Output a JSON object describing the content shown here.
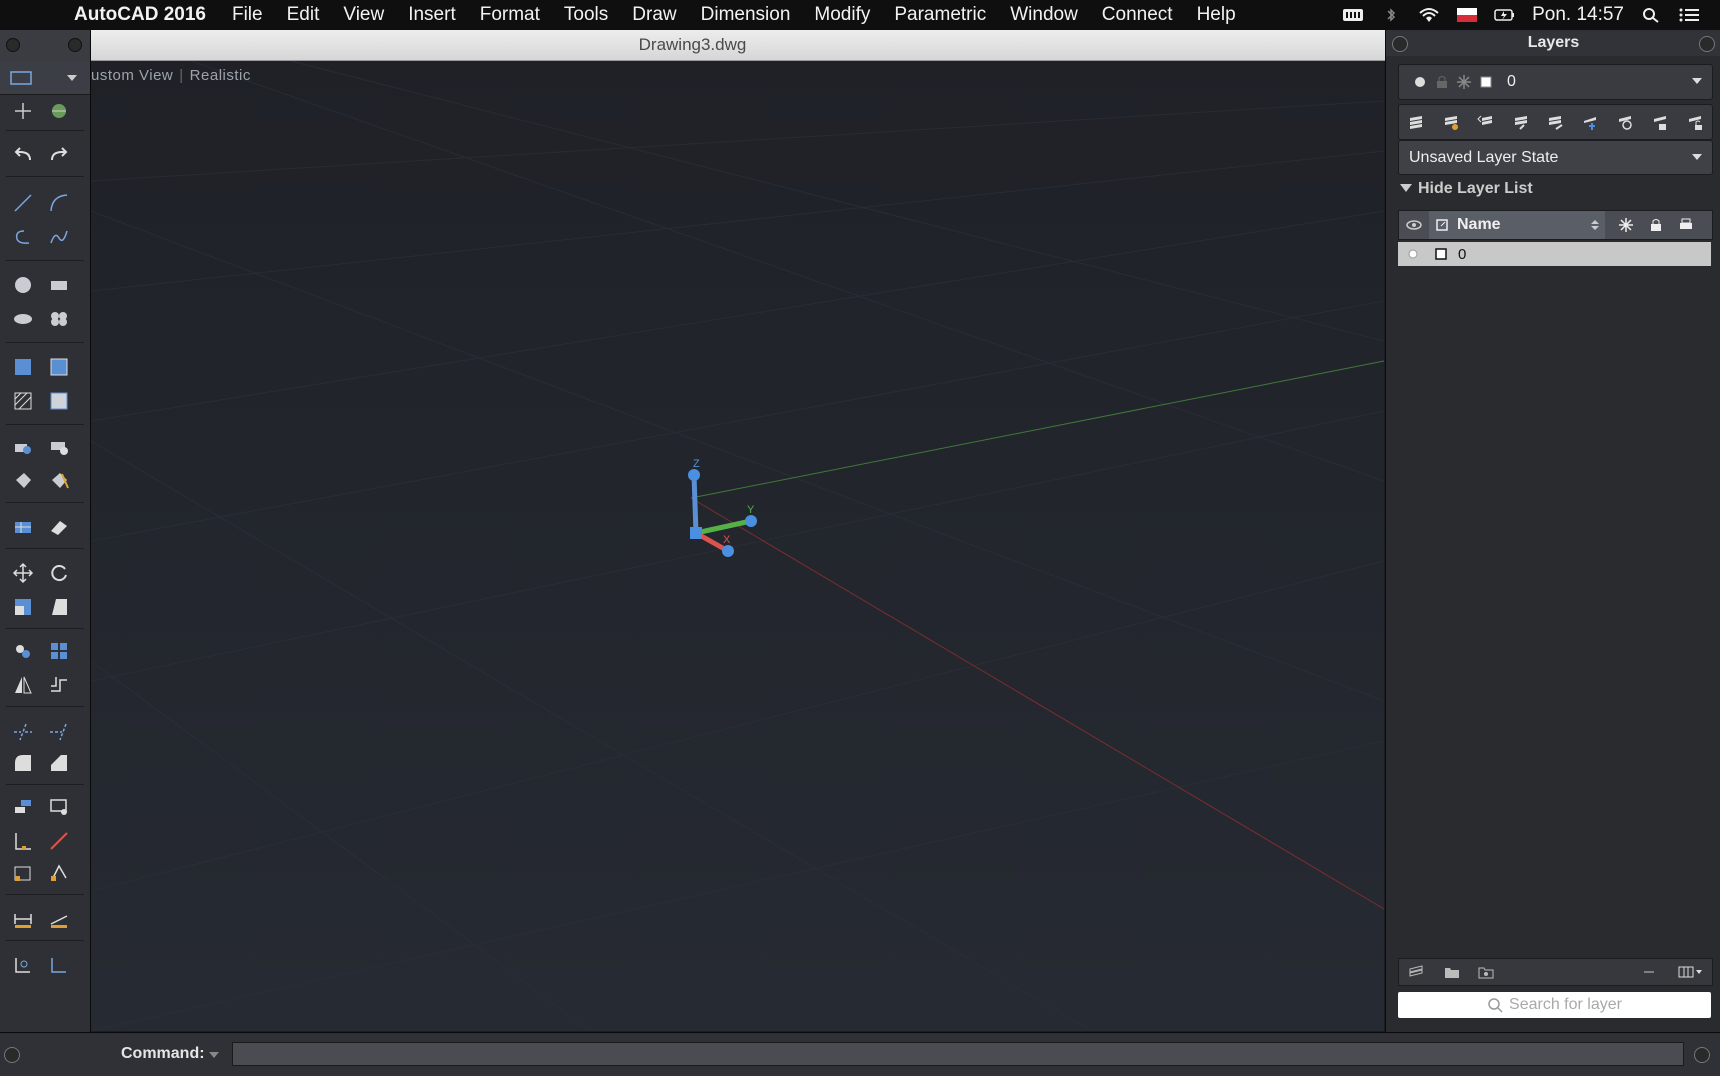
{
  "menubar": {
    "app_name": "AutoCAD 2016",
    "items": [
      "File",
      "Edit",
      "View",
      "Insert",
      "Format",
      "Tools",
      "Draw",
      "Dimension",
      "Modify",
      "Parametric",
      "Window",
      "Connect",
      "Help"
    ],
    "clock": "Pon. 14:57"
  },
  "window": {
    "title": "Drawing3.dwg"
  },
  "viewport": {
    "view_name": "ustom View",
    "visual_style": "Realistic",
    "ucs_labels": {
      "z": "Z",
      "y": "Y",
      "x": "X"
    }
  },
  "layers_panel": {
    "title": "Layers",
    "current_layer": "0",
    "layer_state": "Unsaved Layer State",
    "hide_list_label": "Hide Layer List",
    "column_name": "Name",
    "rows": [
      {
        "name": "0"
      }
    ],
    "search_placeholder": "Search for layer"
  },
  "command": {
    "label": "Command:"
  },
  "colors": {
    "accent_blue": "#4a8fe0",
    "axis_green": "#4caf50",
    "axis_red": "#d9534f"
  }
}
